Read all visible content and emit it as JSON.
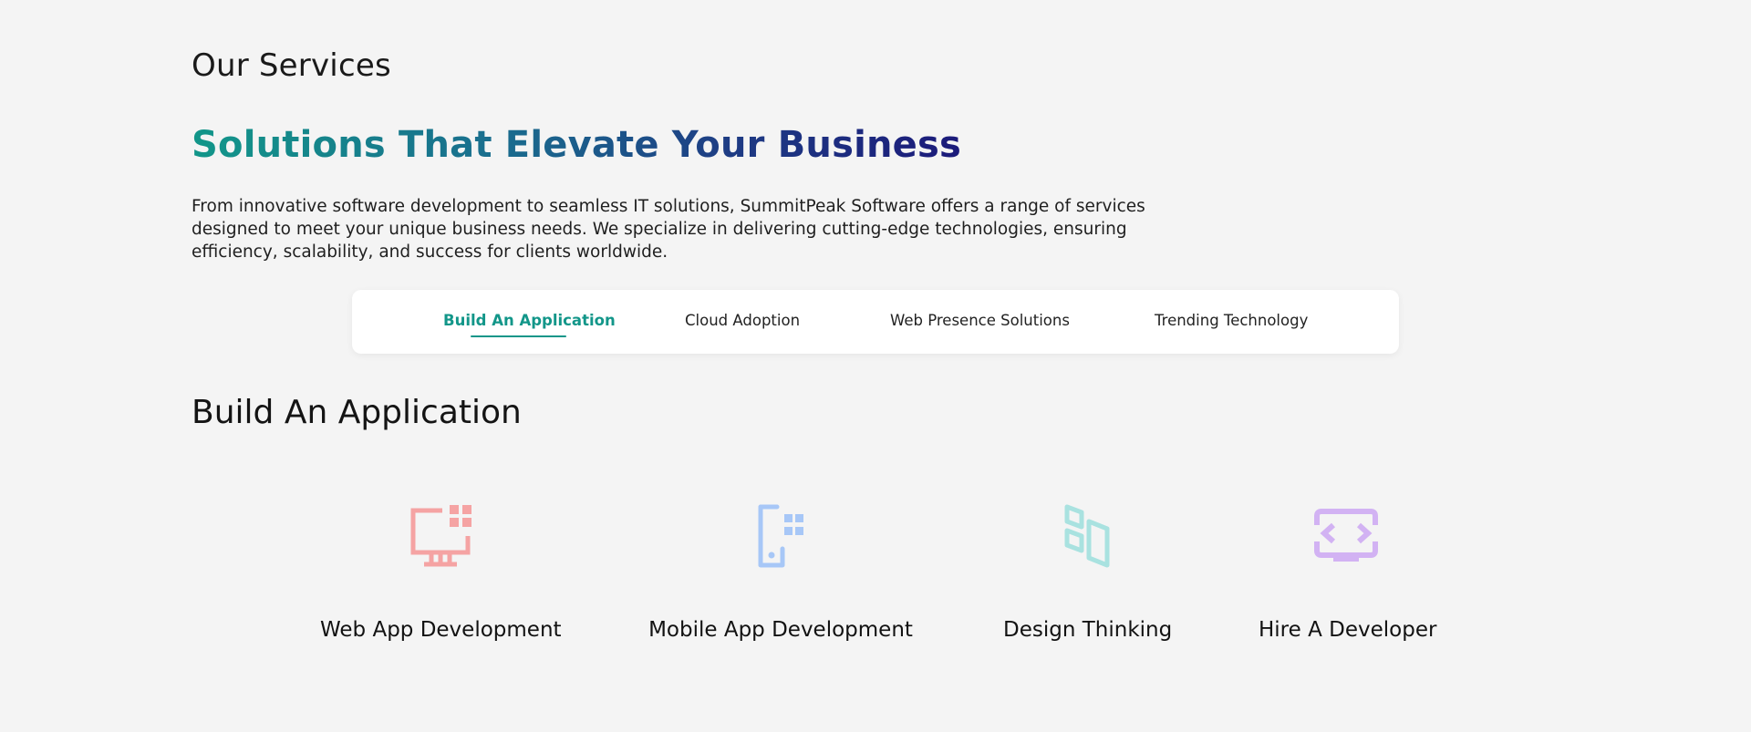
{
  "header": {
    "eyebrow": "Our Services",
    "headline": "Solutions That Elevate Your Business",
    "intro": "From innovative software development to seamless IT solutions, SummitPeak Software offers a range of services designed to meet your unique business needs. We specialize in delivering cutting-edge technologies, ensuring efficiency, scalability, and success for clients worldwide."
  },
  "tabs": [
    {
      "label": "Build An Application",
      "active": true
    },
    {
      "label": "Cloud Adoption",
      "active": false
    },
    {
      "label": "Web Presence Solutions",
      "active": false
    },
    {
      "label": "Trending Technology",
      "active": false
    }
  ],
  "section": {
    "title": "Build An Application"
  },
  "services": [
    {
      "label": "Web App Development",
      "icon": "monitor-grid-icon",
      "color": "#f5a3a3"
    },
    {
      "label": "Mobile App Development",
      "icon": "mobile-grid-icon",
      "color": "#a7c7f7"
    },
    {
      "label": "Design Thinking",
      "icon": "design-blocks-icon",
      "color": "#a9e2e0"
    },
    {
      "label": "Hire A Developer",
      "icon": "code-monitor-icon",
      "color": "#d2b2f3"
    }
  ],
  "colors": {
    "accent": "#129689",
    "headline_gradient": [
      "#129689",
      "#1b1a7a"
    ],
    "background": "#f4f4f4"
  }
}
